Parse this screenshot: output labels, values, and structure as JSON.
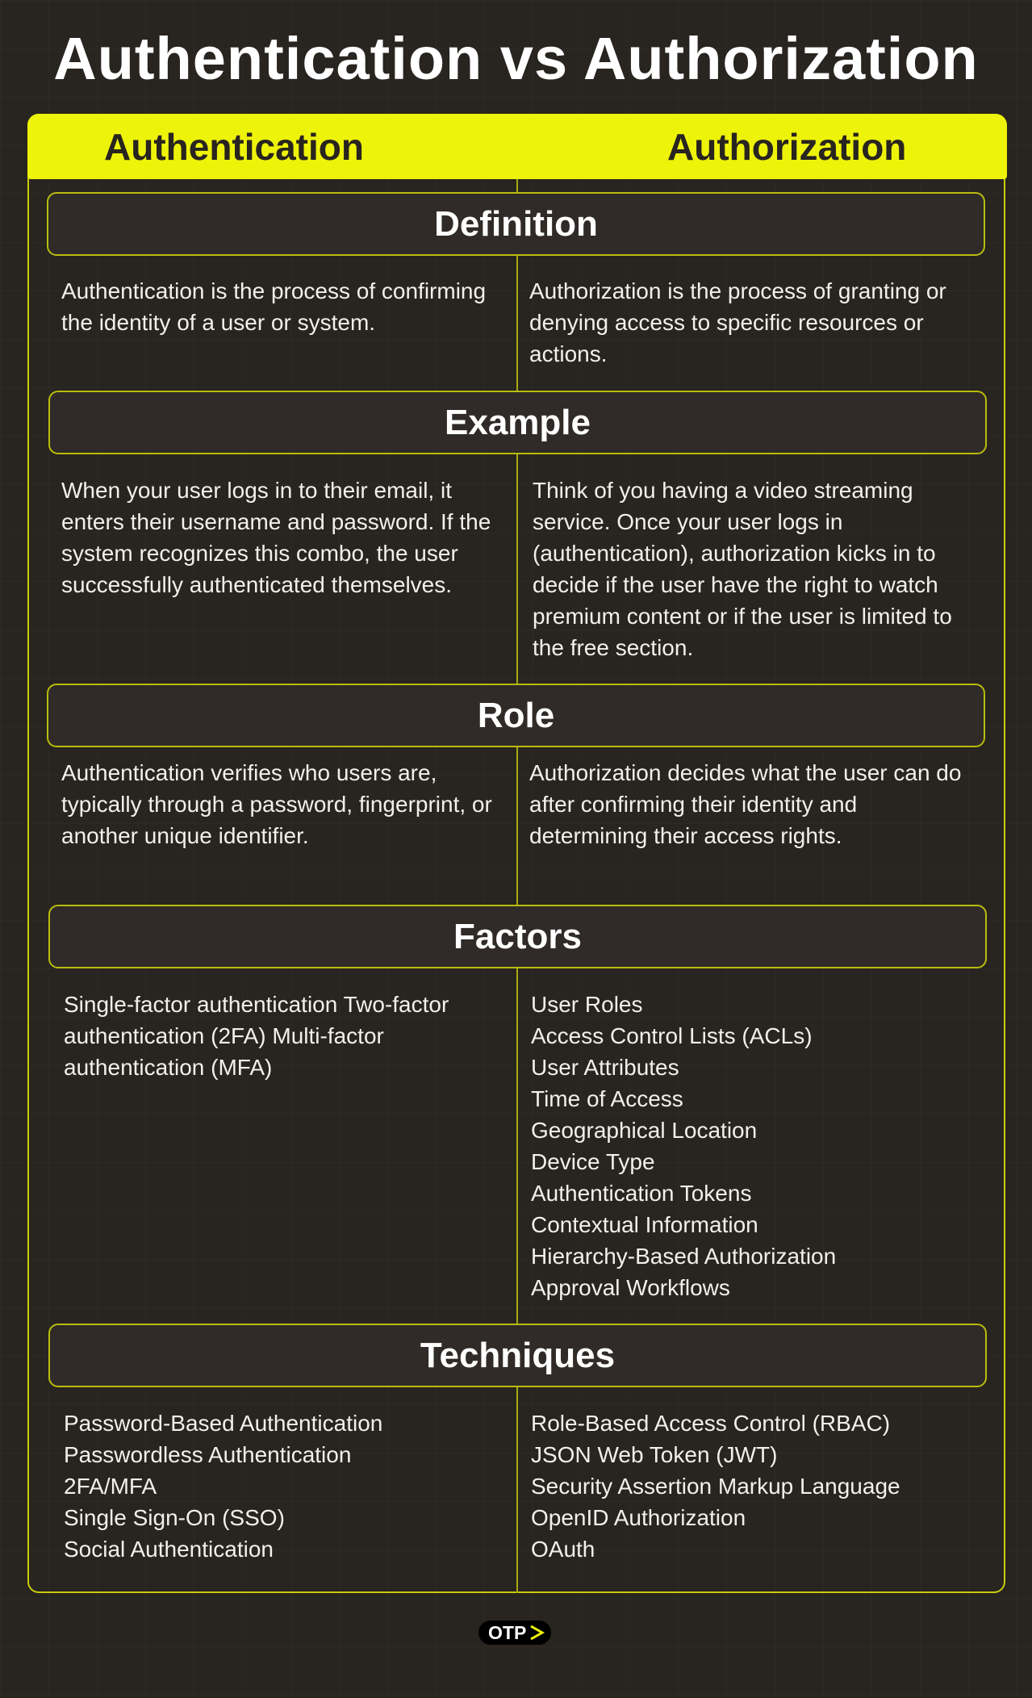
{
  "title": "Authentication vs Authorization",
  "columns": {
    "left": "Authentication",
    "right": "Authorization"
  },
  "sections": {
    "definition": {
      "heading": "Definition",
      "left": "Authentication is the process of confirming the identity of a user or system.",
      "right": "Authorization is the process of granting or denying access to specific resources or actions."
    },
    "example": {
      "heading": "Example",
      "left": "When your user logs in to their email, it enters their username and password. If the system recognizes this combo, the user successfully authenticated themselves.",
      "right": "Think of you having a video streaming service. Once your user logs in (authentication), authorization kicks in to decide if the user have the right to watch premium content or if the user is limited to the free section."
    },
    "role": {
      "heading": "Role",
      "left": "Authentication verifies who users are, typically through a password, fingerprint, or another unique identifier.",
      "right": "Authorization decides what the user can do after confirming their identity and determining their access rights."
    },
    "factors": {
      "heading": "Factors",
      "left": "Single-factor authentication Two-factor authentication (2FA) Multi-factor authentication (MFA)",
      "right": [
        "User Roles",
        "Access Control Lists (ACLs)",
        "User Attributes",
        "Time of Access",
        "Geographical Location",
        "Device Type",
        "Authentication Tokens",
        "Contextual Information",
        "Hierarchy-Based Authorization",
        "Approval Workflows"
      ]
    },
    "techniques": {
      "heading": "Techniques",
      "left": [
        "Password-Based Authentication",
        "Passwordless Authentication",
        "2FA/MFA",
        "Single Sign-On (SSO)",
        "Social Authentication"
      ],
      "right": [
        "Role-Based Access Control (RBAC)",
        "JSON Web Token (JWT)",
        "Security Assertion Markup Language",
        "OpenID Authorization",
        "OAuth"
      ]
    }
  },
  "logo": {
    "text": "OTP",
    "icon": "play-arrow-icon"
  },
  "colors": {
    "background": "#28241f",
    "accent": "#eef30a",
    "panel": "#302b28"
  }
}
